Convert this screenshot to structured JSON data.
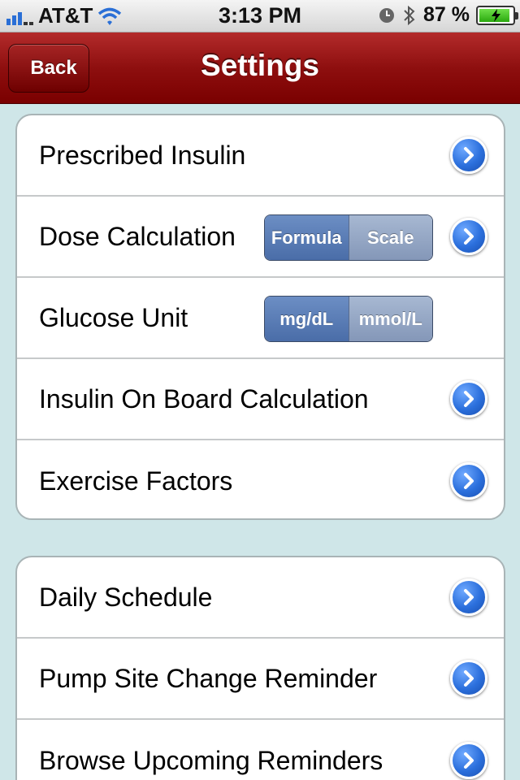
{
  "status_bar": {
    "carrier": "AT&T",
    "time": "3:13 PM",
    "battery_percent": "87 %",
    "battery_level": 0.87,
    "icons": [
      "signal-icon",
      "wifi-icon",
      "clock-icon",
      "bluetooth-icon",
      "battery-charging-icon"
    ]
  },
  "nav": {
    "title": "Settings",
    "back_label": "Back",
    "bar_color": "#8e0f0f"
  },
  "group1": {
    "rows": [
      {
        "label": "Prescribed Insulin",
        "accessory": "chevron-right-icon"
      },
      {
        "label": "Dose Calculation",
        "segments": [
          "Formula",
          "Scale"
        ],
        "selected": "Formula",
        "accessory": "chevron-right-icon"
      },
      {
        "label": "Glucose Unit",
        "segments": [
          "mg/dL",
          "mmol/L"
        ],
        "selected": "mg/dL"
      },
      {
        "label": "Insulin On Board Calculation",
        "accessory": "chevron-right-icon"
      },
      {
        "label": "Exercise Factors",
        "accessory": "chevron-right-icon"
      }
    ]
  },
  "group2": {
    "rows": [
      {
        "label": "Daily Schedule",
        "accessory": "chevron-right-icon"
      },
      {
        "label": "Pump Site Change Reminder",
        "accessory": "chevron-right-icon"
      },
      {
        "label": "Browse Upcoming Reminders",
        "accessory": "chevron-right-icon"
      }
    ]
  },
  "colors": {
    "background": "#cfe6e8",
    "disclosure_blue": "#2b6fdc",
    "segment_selected": "#4a6da8"
  }
}
